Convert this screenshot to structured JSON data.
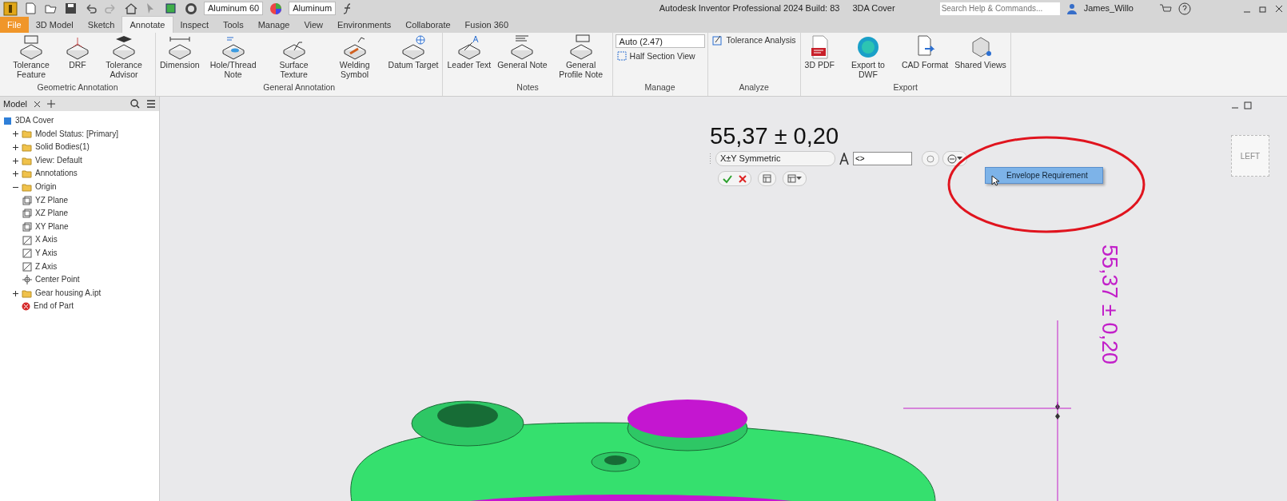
{
  "quick_access": {
    "material": "Aluminum 60",
    "appearance": "Aluminum"
  },
  "title_bar": {
    "app_title": "Autodesk Inventor Professional 2024 Build: 83",
    "document": "3DA Cover",
    "search": {
      "placeholder": "Search Help & Commands..."
    },
    "user": "James_Willo"
  },
  "ribbon_tabs": [
    {
      "label": "File",
      "kind": "file",
      "selected": false
    },
    {
      "label": "3D Model",
      "kind": "tab",
      "selected": false
    },
    {
      "label": "Sketch",
      "kind": "tab",
      "selected": false
    },
    {
      "label": "Annotate",
      "kind": "tab",
      "selected": true
    },
    {
      "label": "Inspect",
      "kind": "tab",
      "selected": false
    },
    {
      "label": "Tools",
      "kind": "tab",
      "selected": false
    },
    {
      "label": "Manage",
      "kind": "tab",
      "selected": false
    },
    {
      "label": "View",
      "kind": "tab",
      "selected": false
    },
    {
      "label": "Environments",
      "kind": "tab",
      "selected": false
    },
    {
      "label": "Collaborate",
      "kind": "tab",
      "selected": false
    },
    {
      "label": "Fusion 360",
      "kind": "tab",
      "selected": false
    }
  ],
  "ribbon_panels": [
    {
      "title": "Geometric Annotation",
      "kind": "buttons",
      "buttons": [
        "Tolerance Feature",
        "DRF",
        "Tolerance Advisor"
      ]
    },
    {
      "title": "General Annotation",
      "kind": "buttons",
      "buttons": [
        "Dimension",
        "Hole/Thread Note",
        "Surface Texture",
        "Welding Symbol",
        "Datum Target"
      ]
    },
    {
      "title": "Notes",
      "kind": "buttons",
      "buttons": [
        "Leader Text",
        "General Note",
        "General Profile Note"
      ]
    },
    {
      "title": "Manage",
      "kind": "manage",
      "dropdown": "Auto (2.47)",
      "command": "Half Section View"
    },
    {
      "title": "Analyze",
      "kind": "command",
      "command": "Tolerance Analysis"
    },
    {
      "title": "Export",
      "kind": "buttons",
      "buttons": [
        "3D PDF",
        "Export to DWF",
        "CAD Format",
        "Shared Views"
      ]
    }
  ],
  "browser": {
    "tab": "Model",
    "tree": [
      {
        "label": "3DA Cover",
        "children": [
          {
            "label": "Model Status: [Primary]",
            "expanded": false
          },
          {
            "label": "Solid Bodies(1)",
            "expanded": false
          },
          {
            "label": "View: Default",
            "expanded": false
          },
          {
            "label": "Annotations",
            "expanded": false
          },
          {
            "label": "Origin",
            "expanded": true,
            "children": [
              {
                "label": "YZ Plane"
              },
              {
                "label": "XZ Plane"
              },
              {
                "label": "XY Plane"
              },
              {
                "label": "X Axis"
              },
              {
                "label": "Y Axis"
              },
              {
                "label": "Z Axis"
              },
              {
                "label": "Center Point"
              }
            ]
          },
          {
            "label": "Gear housing A.ipt",
            "expanded": false
          },
          {
            "label": "End of Part"
          }
        ]
      }
    ]
  },
  "viewport": {
    "dimension_edit": "55,37 ± 0,20",
    "mini_toolbar": {
      "tolerance_type": "X±Y Symmetric",
      "text_value": "<>"
    },
    "menu": [
      {
        "label": "Envelope Requirement",
        "selected": true
      }
    ],
    "view_cube": "LEFT",
    "model_dimension": "55,37 ± 0,20"
  }
}
